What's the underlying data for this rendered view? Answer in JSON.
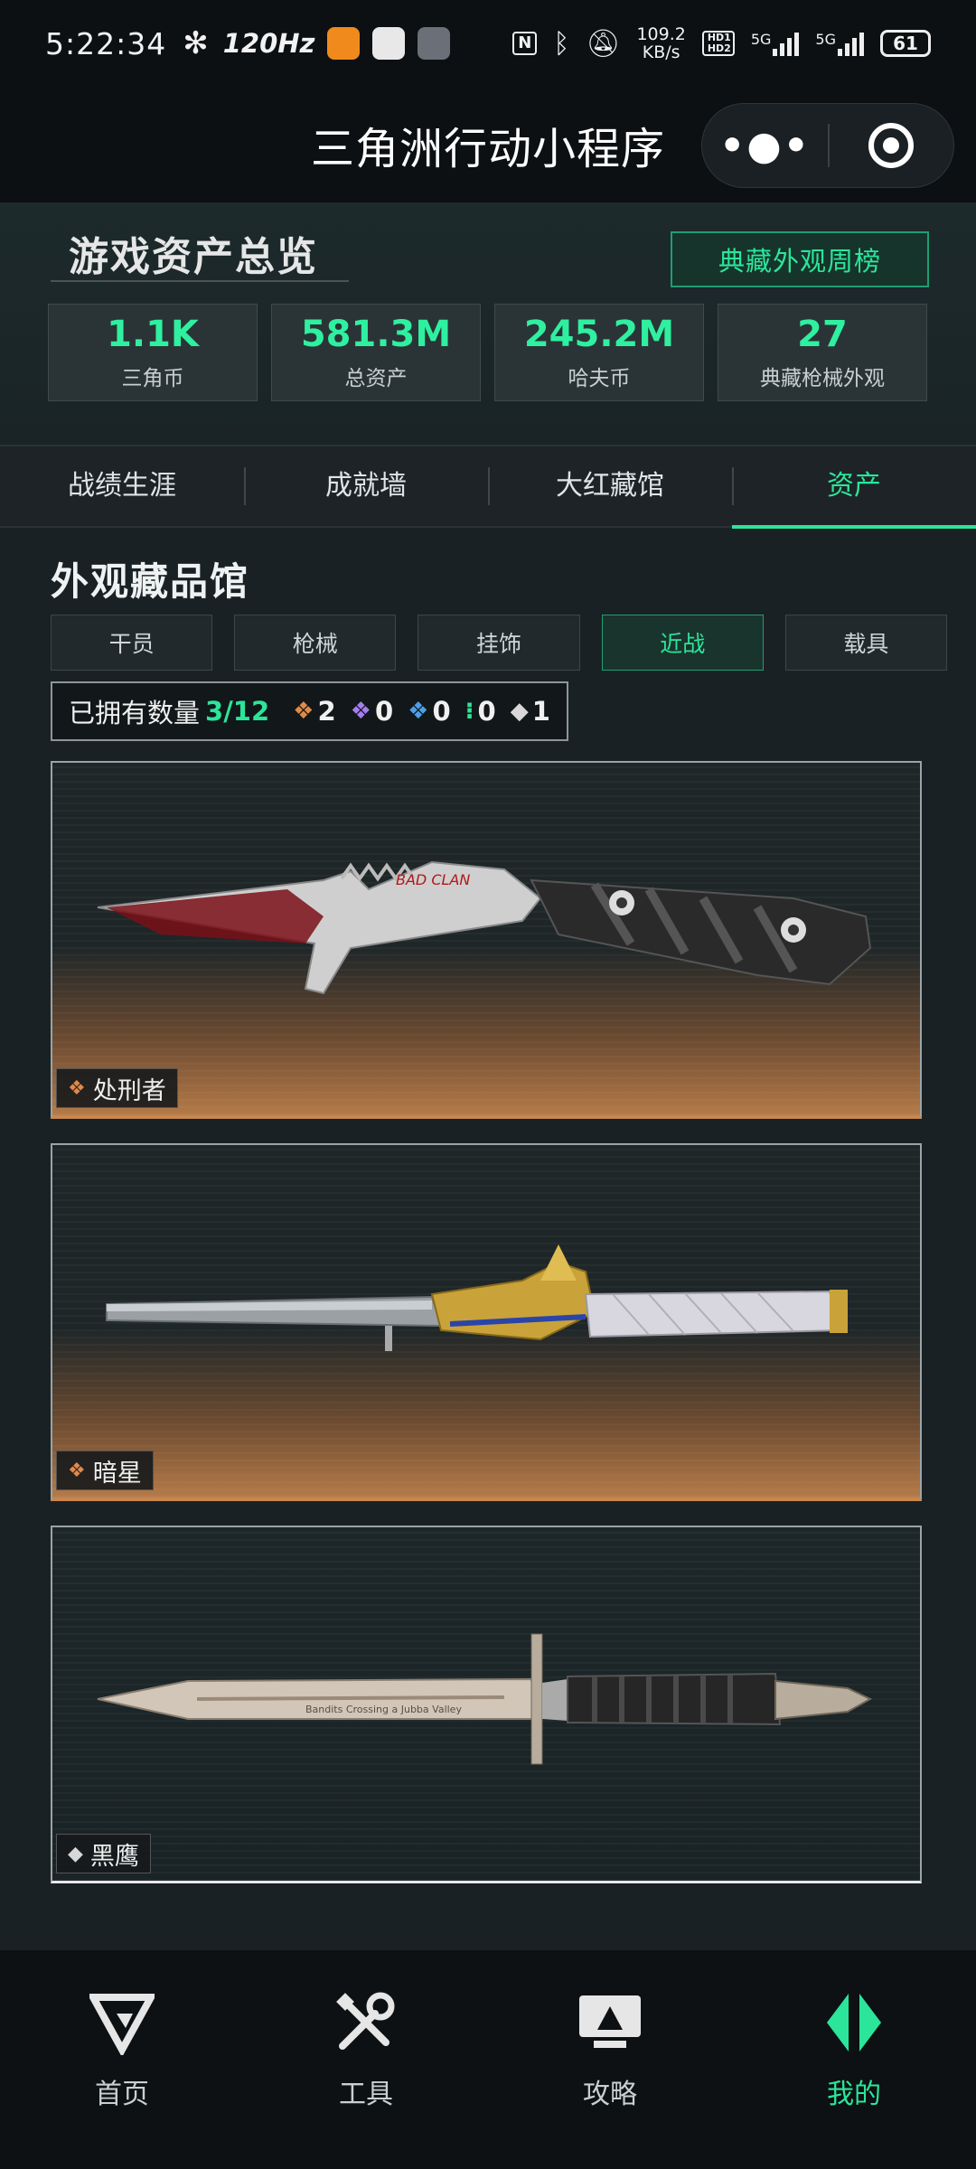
{
  "status_bar": {
    "time": "5:22:34",
    "refresh_rate": "120Hz",
    "net_speed_value": "109.2",
    "net_speed_unit": "KB/s",
    "hd_label": "HD1 HD2",
    "sim1": "5G",
    "sim2": "5G",
    "battery": "61"
  },
  "title_bar": {
    "title": "三角洲行动小程序",
    "more_icon": "more-dots-icon",
    "close_icon": "target-close-icon"
  },
  "overview": {
    "heading": "游戏资产总览",
    "rank_button": "典藏外观周榜",
    "stats": [
      {
        "value": "1.1K",
        "label": "三角币"
      },
      {
        "value": "581.3M",
        "label": "总资产"
      },
      {
        "value": "245.2M",
        "label": "哈夫币"
      },
      {
        "value": "27",
        "label": "典藏枪械外观"
      }
    ]
  },
  "main_tabs": [
    {
      "label": "战绩生涯",
      "active": false
    },
    {
      "label": "成就墙",
      "active": false
    },
    {
      "label": "大红藏馆",
      "active": false
    },
    {
      "label": "资产",
      "active": true
    }
  ],
  "collection": {
    "title": "外观藏品馆",
    "sub_tabs": [
      {
        "label": "干员",
        "active": false
      },
      {
        "label": "枪械",
        "active": false
      },
      {
        "label": "挂饰",
        "active": false
      },
      {
        "label": "近战",
        "active": true
      },
      {
        "label": "载具",
        "active": false
      }
    ],
    "owned_label": "已拥有数量",
    "owned_count": "3/12",
    "rarity_counts": [
      {
        "icon": "gold-diamond-icon",
        "color": "#e08a4a",
        "count": "2"
      },
      {
        "icon": "purple-diamond-icon",
        "color": "#a77cf2",
        "count": "0"
      },
      {
        "icon": "blue-diamond-icon",
        "color": "#4d9ee8",
        "count": "0"
      },
      {
        "icon": "green-diamond-icon",
        "color": "#2be59a",
        "count": "0"
      },
      {
        "icon": "white-diamond-icon",
        "color": "#d8d8d8",
        "count": "1"
      }
    ],
    "items": [
      {
        "name": "处刑者",
        "rarity_color": "#e08a4a",
        "blade_text": "BAD CLAN"
      },
      {
        "name": "暗星",
        "rarity_color": "#e08a4a",
        "blade_text": ""
      },
      {
        "name": "黑鹰",
        "rarity_color": "#d8d8d8",
        "blade_text": "Bandits Crossing a Jubba Valley"
      }
    ]
  },
  "bottom_nav": [
    {
      "label": "首页",
      "icon": "delta-logo-icon",
      "active": false
    },
    {
      "label": "工具",
      "icon": "tools-icon",
      "active": false
    },
    {
      "label": "攻略",
      "icon": "guide-monitor-icon",
      "active": false
    },
    {
      "label": "我的",
      "icon": "profile-logo-icon",
      "active": true
    }
  ],
  "colors": {
    "accent": "#2be59a",
    "background": "#1a2124",
    "gold_rarity": "#e08a4a"
  }
}
